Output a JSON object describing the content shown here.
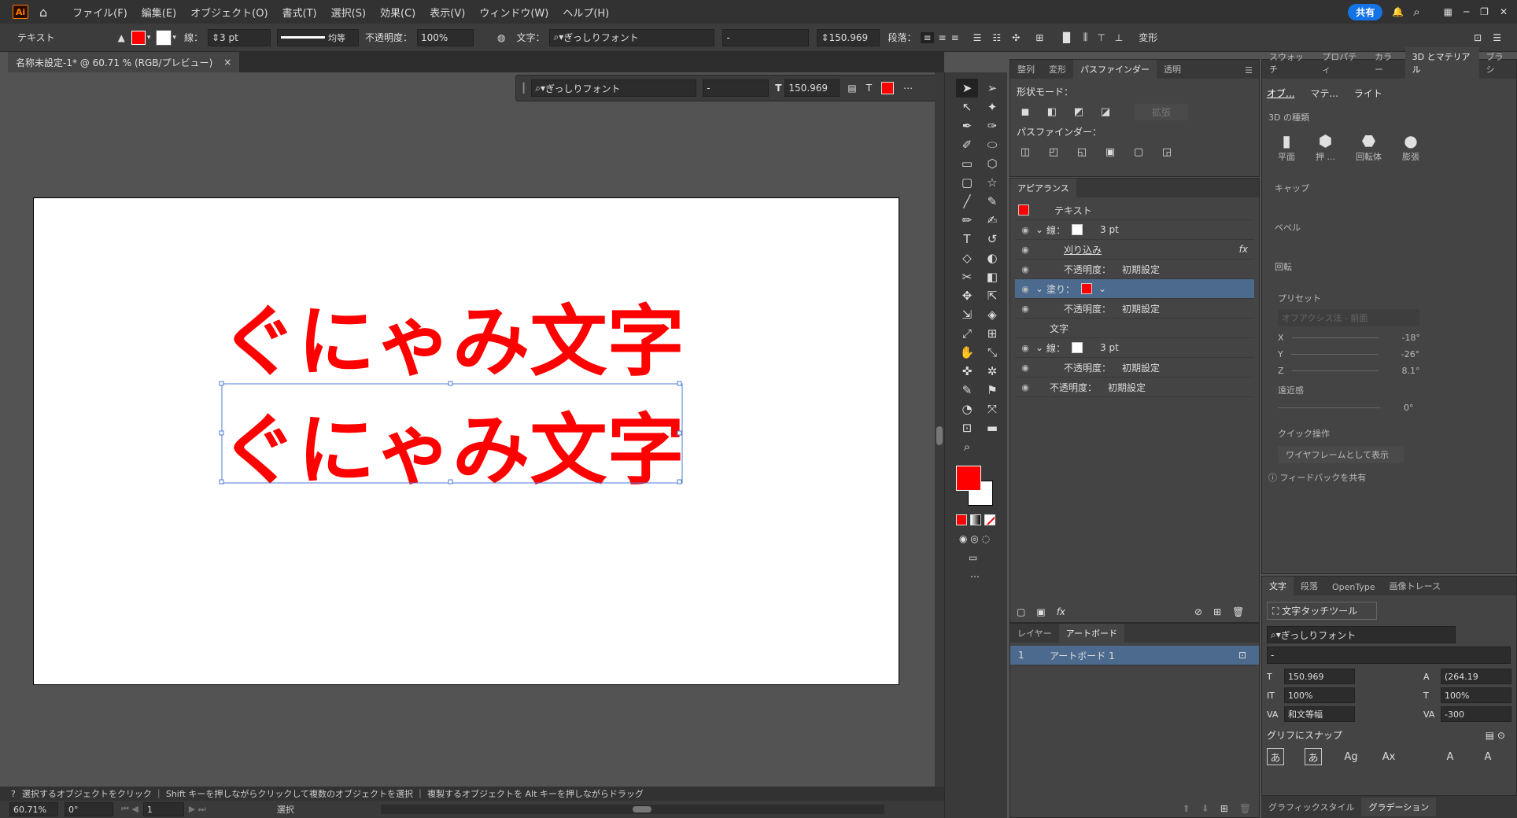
{
  "menubar": {
    "app_icon": "Ai",
    "items": [
      "ファイル(F)",
      "編集(E)",
      "オブジェクト(O)",
      "書式(T)",
      "選択(S)",
      "効果(C)",
      "表示(V)",
      "ウィンドウ(W)",
      "ヘルプ(H)"
    ],
    "share": "共有"
  },
  "control": {
    "mode": "テキスト",
    "stroke_label": "線：",
    "stroke_value": "3 pt",
    "stroke_style": "均等",
    "opacity_label": "不透明度：",
    "opacity_value": "100%",
    "char_label": "文字：",
    "font": "ぎっしりフォント",
    "style": "-",
    "size": "150.969",
    "para_label": "段落：",
    "transform": "変形"
  },
  "doc": {
    "tab": "名称未設定-1* @ 60.71 % (RGB/プレビュー)",
    "close": "×"
  },
  "float_toolbar": {
    "font": "ぎっしりフォント",
    "style": "-",
    "size": "150.969"
  },
  "artwork": {
    "text1": "ぐにゃみ文字",
    "text2": "ぐにゃみ文字",
    "color": "#ff0000"
  },
  "status": {
    "hint": "選択するオブジェクトをクリック ｜ Shift キーを押しながらクリックして複数のオブジェクトを選択 ｜ 複製するオブジェクトを Alt キーを押しながらドラッグ",
    "zoom": "60.71%",
    "rotate": "0°",
    "page": "1",
    "tool": "選択"
  },
  "pathfinder": {
    "tabs": [
      "整列",
      "変形",
      "パスファインダー",
      "透明"
    ],
    "shape_modes": "形状モード：",
    "expand": "拡張",
    "pathfinders": "パスファインダー："
  },
  "appearance": {
    "tab": "アピアランス",
    "rows": [
      {
        "label": "テキスト"
      },
      {
        "label": "線：",
        "value": "3 pt"
      },
      {
        "label": "刈り込み"
      },
      {
        "label": "不透明度：",
        "value": "初期設定"
      },
      {
        "label": "塗り："
      },
      {
        "label": "不透明度：",
        "value": "初期設定"
      },
      {
        "label": "文字"
      },
      {
        "label": "線：",
        "value": "3 pt"
      },
      {
        "label": "不透明度：",
        "value": "初期設定"
      },
      {
        "label": "不透明度：",
        "value": "初期設定"
      }
    ],
    "fx": "fx"
  },
  "layers": {
    "tabs": [
      "レイヤー",
      "アートボード"
    ],
    "row_num": "1",
    "row_name": "アートボード 1"
  },
  "right_panel": {
    "tabs": [
      "スウォッチ",
      "プロパティ",
      "カラー",
      "3D とマテリアル",
      "ブラシ"
    ],
    "subtabs": [
      "オブ...",
      "マテ...",
      "ライト"
    ],
    "type_label": "3D の種類",
    "types": [
      "平面",
      "押 ...",
      "回転体",
      "膨張"
    ],
    "cap": "キャップ",
    "bevel": "ベベル",
    "rotation": "回転",
    "preset_label": "プリセット",
    "preset": "オフアクシス法 - 前面",
    "x_label": "X",
    "x_val": "-18°",
    "y_label": "Y",
    "y_val": "-26°",
    "z_label": "Z",
    "z_val": "8.1°",
    "persp": "遠近感",
    "persp_val": "0°",
    "quick": "クイック操作",
    "wire": "ワイヤフレームとして表示",
    "feedback": "フィードバックを共有"
  },
  "char_panel": {
    "tabs": [
      "文字",
      "段落",
      "OpenType",
      "画像トレース"
    ],
    "touch": "文字タッチツール",
    "font": "ぎっしりフォント",
    "style": "-",
    "size": "150.969",
    "leading": "(264.19",
    "vscale": "100%",
    "hscale": "100%",
    "kern": "和文等幅",
    "track": "-300",
    "snap": "グリフにスナップ"
  },
  "bottom_tabs": [
    "グラフィックスタイル",
    "グラデーション"
  ]
}
